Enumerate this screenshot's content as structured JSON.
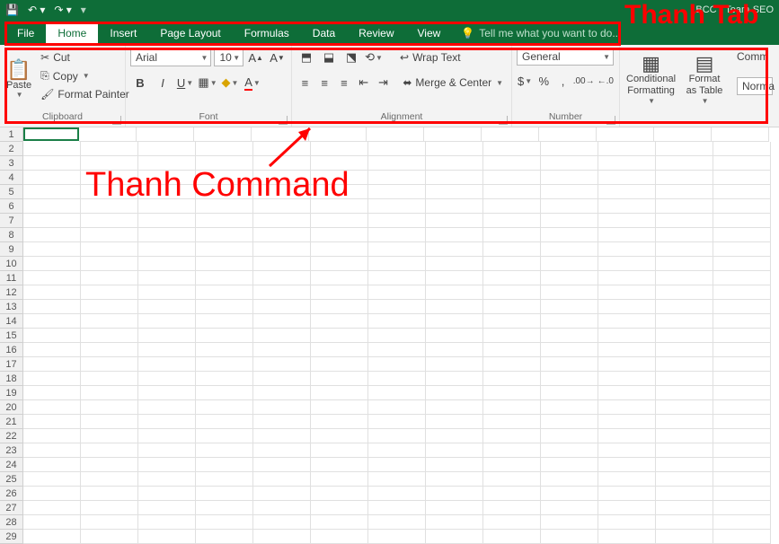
{
  "titlebar": {
    "docname": "BCC - Team-SEO"
  },
  "tabs": {
    "file": "File",
    "home": "Home",
    "insert": "Insert",
    "pagelayout": "Page Layout",
    "formulas": "Formulas",
    "data": "Data",
    "review": "Review",
    "view": "View",
    "tellme": "Tell me what you want to do..."
  },
  "clipboard": {
    "paste": "Paste",
    "cut": "Cut",
    "copy": "Copy",
    "formatpainter": "Format Painter",
    "label": "Clipboard"
  },
  "font": {
    "name": "Arial",
    "size": "10",
    "label": "Font"
  },
  "alignment": {
    "wraptext": "Wrap Text",
    "merge": "Merge & Center",
    "label": "Alignment"
  },
  "number": {
    "format": "General",
    "label": "Number"
  },
  "styles": {
    "conditional": "Conditional Formatting",
    "formatastable": "Format as Table",
    "cellstyles": "Comm"
  },
  "cells": {
    "normal": "Norma"
  },
  "annotations": {
    "tab": "Thanh Tab",
    "command": "Thanh Command"
  },
  "rowcount": 29
}
